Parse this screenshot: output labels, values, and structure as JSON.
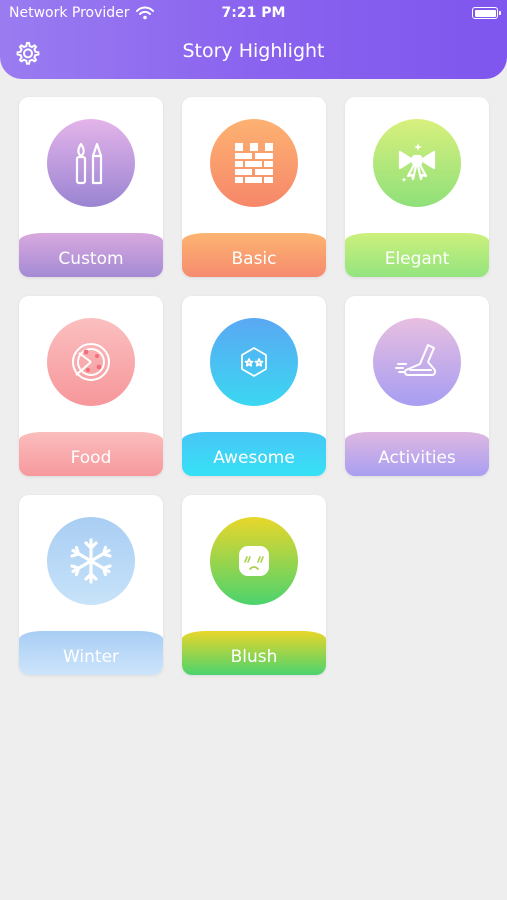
{
  "status_bar": {
    "carrier": "Network Provider",
    "time": "7:21 PM"
  },
  "header": {
    "title": "Story Highlight",
    "settings_icon": "gear-icon"
  },
  "categories": [
    {
      "label": "Custom",
      "icon": "brush-pencil-icon",
      "circle_from": "#e4b4ea",
      "circle_to": "#9a84d2",
      "bar_from": "#d9a9df",
      "bar_to": "#a48ad4"
    },
    {
      "label": "Basic",
      "icon": "brick-wall-icon",
      "circle_from": "#fdb271",
      "circle_to": "#f6876a",
      "bar_from": "#fcb470",
      "bar_to": "#f68b6f"
    },
    {
      "label": "Elegant",
      "icon": "bow-icon",
      "circle_from": "#d8f07d",
      "circle_to": "#8fe07a",
      "bar_from": "#cdf07c",
      "bar_to": "#93e47f"
    },
    {
      "label": "Food",
      "icon": "pizza-icon",
      "circle_from": "#fbbfbf",
      "circle_to": "#f6979b",
      "bar_from": "#fbbdbd",
      "bar_to": "#f6999d"
    },
    {
      "label": "Awesome",
      "icon": "star-eyes-hexagon-icon",
      "circle_from": "#5aa8f3",
      "circle_to": "#3bd7f2",
      "bar_from": "#48c6f6",
      "bar_to": "#36e1f5"
    },
    {
      "label": "Activities",
      "icon": "running-shoe-icon",
      "circle_from": "#e7bfe0",
      "circle_to": "#a79df2",
      "bar_from": "#dfb8e2",
      "bar_to": "#a89ef1"
    },
    {
      "label": "Winter",
      "icon": "snowflake-icon",
      "circle_from": "#a9cdf3",
      "circle_to": "#c7e3f9",
      "bar_from": "#a8cdf4",
      "bar_to": "#cde5fb"
    },
    {
      "label": "Blush",
      "icon": "blush-face-icon",
      "circle_from": "#e9d62a",
      "circle_to": "#4bd36e",
      "bar_from": "#e9d62a",
      "bar_to": "#4bd36e"
    }
  ]
}
